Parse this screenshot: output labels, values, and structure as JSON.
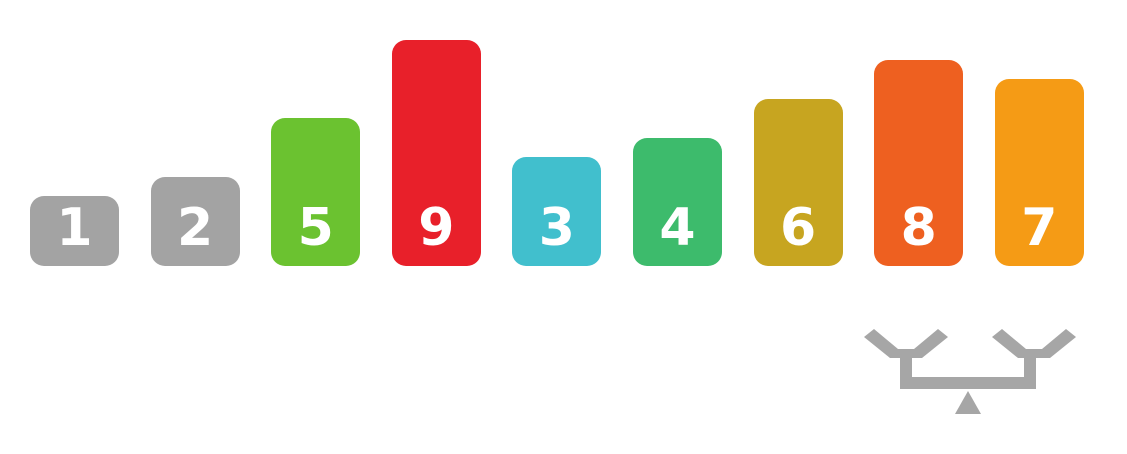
{
  "bars": [
    {
      "label": "1",
      "value": 1,
      "color": "#a3a3a3"
    },
    {
      "label": "2",
      "value": 2,
      "color": "#a3a3a3"
    },
    {
      "label": "5",
      "value": 5,
      "color": "#6bc230"
    },
    {
      "label": "9",
      "value": 9,
      "color": "#e8202a"
    },
    {
      "label": "3",
      "value": 3,
      "color": "#41bfcd"
    },
    {
      "label": "4",
      "value": 4,
      "color": "#3dbb6c"
    },
    {
      "label": "6",
      "value": 6,
      "color": "#c7a520"
    },
    {
      "label": "8",
      "value": 8,
      "color": "#ee6020"
    },
    {
      "label": "7",
      "value": 7,
      "color": "#f59b15"
    }
  ],
  "balance": {
    "icon": "balance-scale-icon",
    "color": "#a6a6a6"
  }
}
